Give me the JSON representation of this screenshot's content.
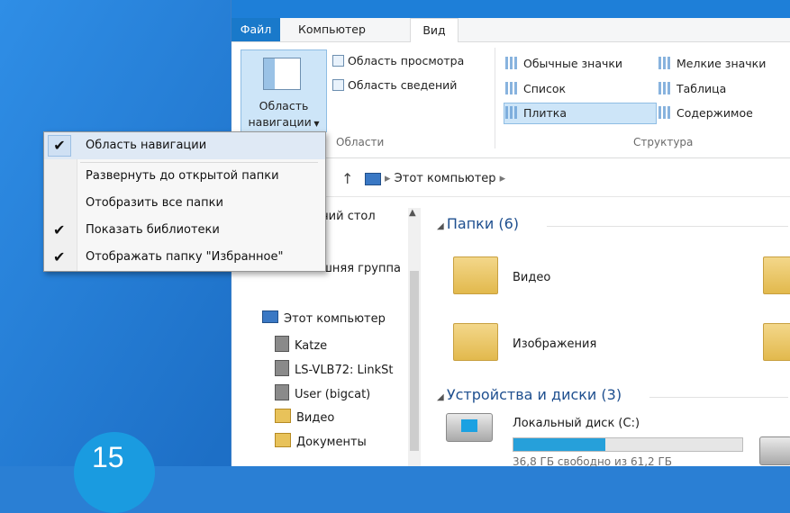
{
  "ribbon": {
    "tabs": [
      "Файл",
      "Компьютер",
      "Вид"
    ],
    "nav_pane_btn": [
      "Область",
      "навигации"
    ],
    "preview_pane": "Область просмотра",
    "details_pane": "Область сведений",
    "group_panes": "Области",
    "layout": {
      "large_icons": "Обычные значки",
      "small_icons": "Мелкие значки",
      "list": "Список",
      "details": "Таблица",
      "tiles": "Плитка",
      "content": "Содержимое",
      "group": "Структура"
    }
  },
  "dropdown_menu": {
    "items": [
      {
        "label": "Область навигации",
        "checked": true
      },
      {
        "label": "Развернуть до открытой папки",
        "checked": false
      },
      {
        "label": "Отобразить все папки",
        "checked": false
      },
      {
        "label": "Показать библиотеки",
        "checked": true
      },
      {
        "label": "Отображать папку \"Избранное\"",
        "checked": true
      }
    ]
  },
  "address_bar": {
    "path": "Этот компьютер"
  },
  "nav_pane": {
    "desktop_partial": "чий стол",
    "homegroup_partial": "шняя группа",
    "this_pc": "Этот компьютер",
    "items": [
      "Katze",
      "LS-VLB72: LinkSt",
      "User (bigcat)",
      "Видео",
      "Документы"
    ]
  },
  "content": {
    "folders_header": "Папки (6)",
    "folders": [
      "Видео",
      "Изображения"
    ],
    "devices_header": "Устройства и диски (3)",
    "drive_name": "Локальный диск (C:)",
    "drive_used_fraction": 0.4,
    "drive_free": "36,8 ГБ свободно из 61,2 ГБ"
  },
  "badge_text": "15"
}
